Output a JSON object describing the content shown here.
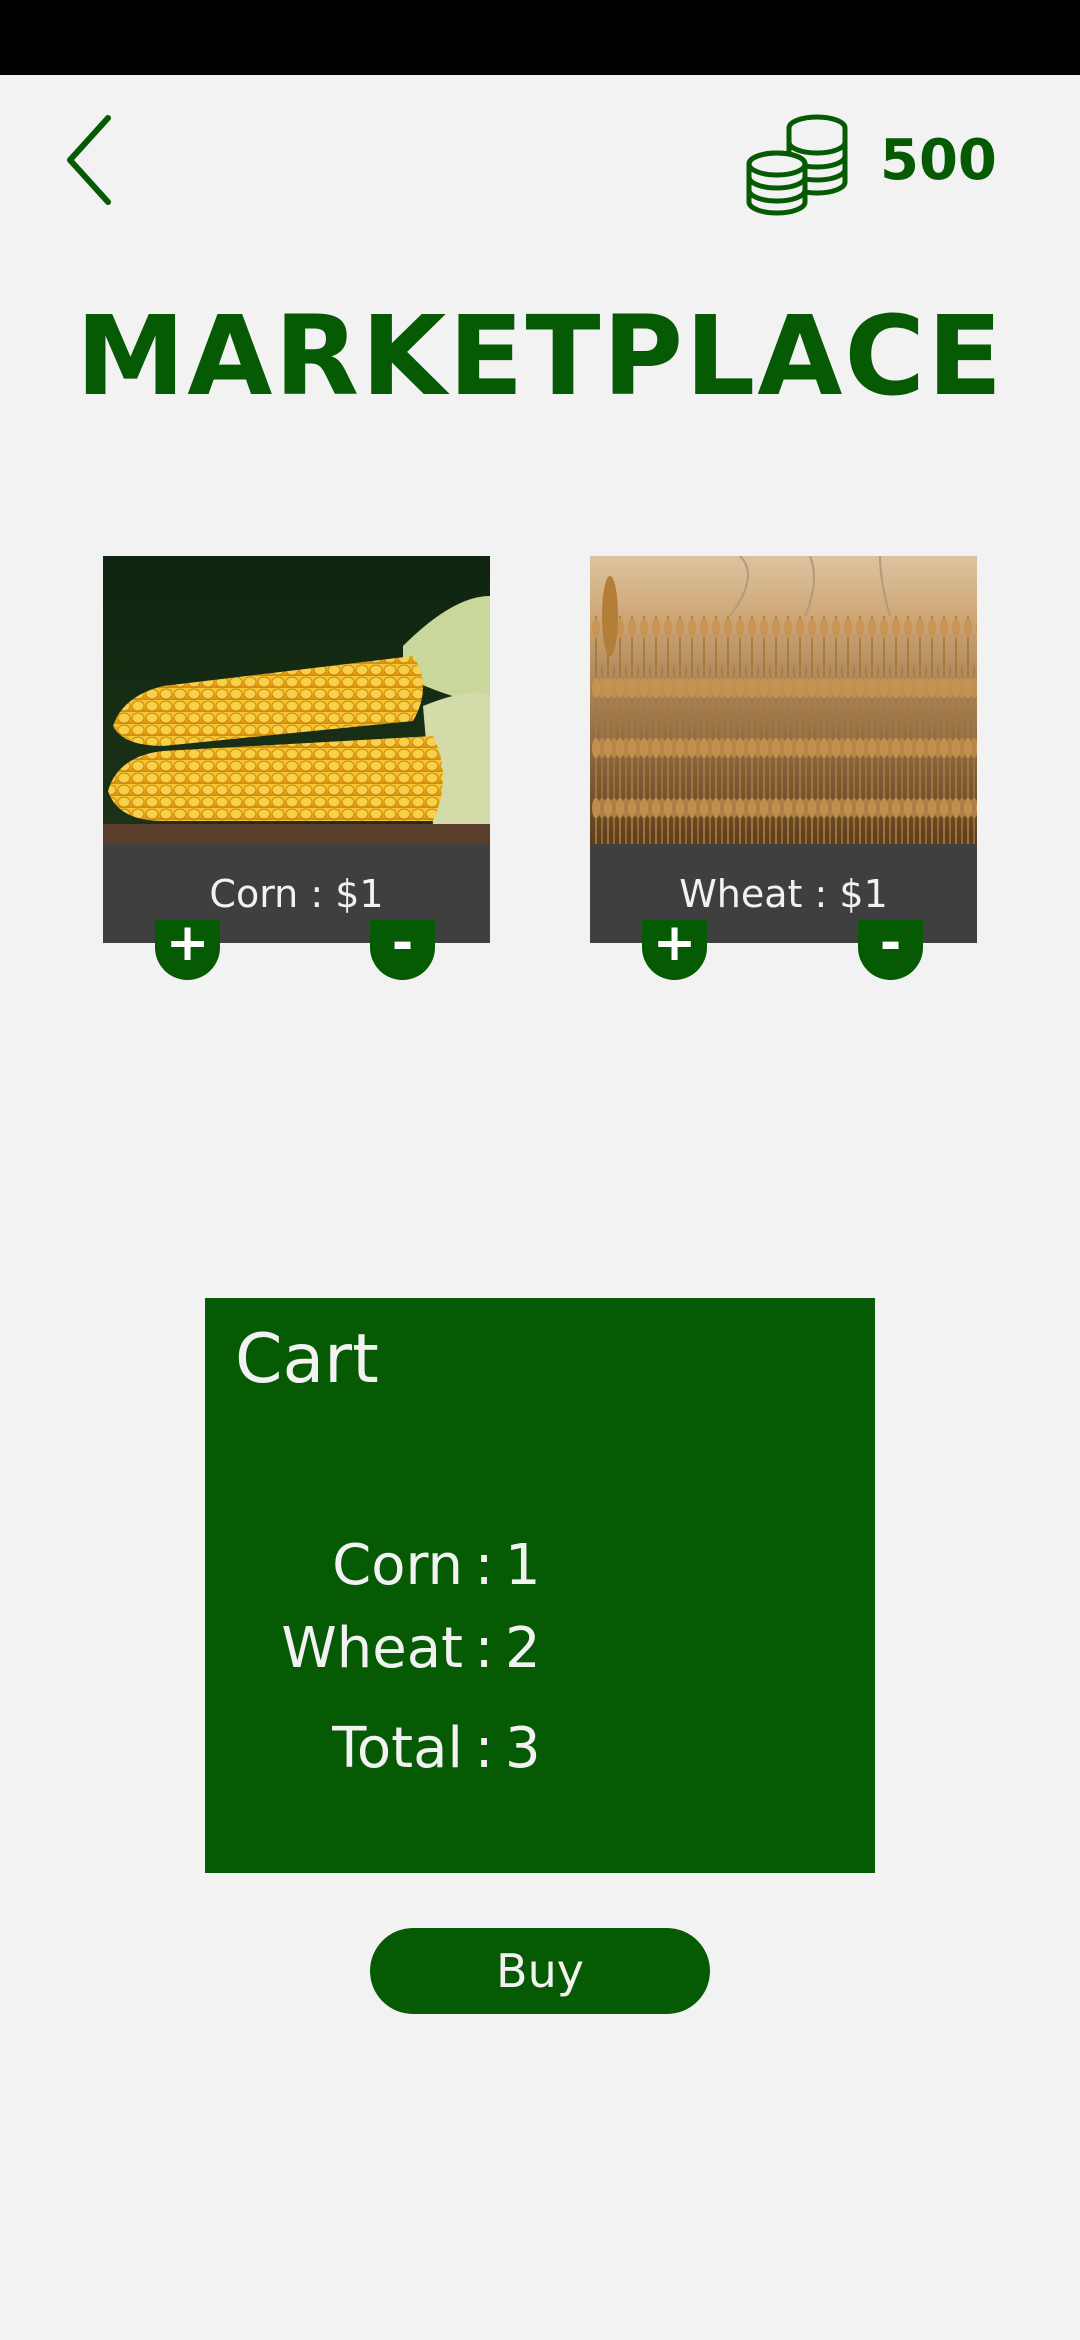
{
  "header": {
    "coin_balance": "500",
    "back_icon": "chevron-left-icon",
    "coins_icon": "coin-stack-icon"
  },
  "title": "MARKETPLACE",
  "products": [
    {
      "label": "Corn : $1",
      "image": "corn-photo"
    },
    {
      "label": "Wheat : $1",
      "image": "wheat-photo"
    }
  ],
  "controls": {
    "plus": "+",
    "minus": "-"
  },
  "cart": {
    "title": "Cart",
    "rows": [
      {
        "name": "Corn",
        "sep": ":",
        "value": "1"
      },
      {
        "name": "Wheat",
        "sep": ":",
        "value": "2"
      },
      {
        "name": "Total",
        "sep": ":",
        "value": "3"
      }
    ]
  },
  "buy_label": "Buy",
  "colors": {
    "primary": "#055a03",
    "background": "#f2f2f2",
    "label_bar": "#3f3f3f"
  }
}
